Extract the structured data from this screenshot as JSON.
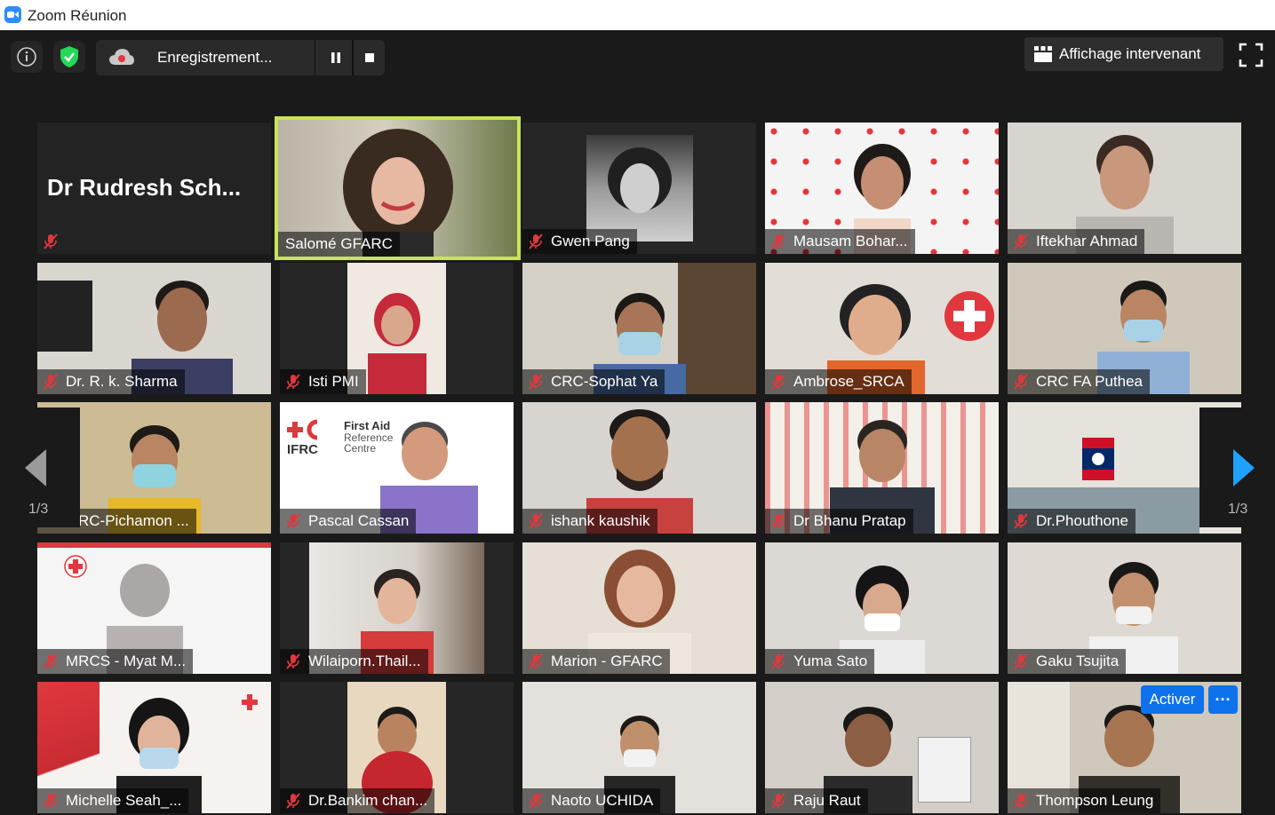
{
  "window": {
    "title": "Zoom Réunion"
  },
  "topbar": {
    "recording_label": "Enregistrement...",
    "view_label": "Affichage intervenant"
  },
  "navigation": {
    "left_page": "1/3",
    "right_page": "1/3"
  },
  "tile_actions": {
    "activate_label": "Activer",
    "more_label": "···"
  },
  "no_video_name": "Dr Rudresh Sch...",
  "participants": [
    {
      "name": "",
      "muted": true
    },
    {
      "name": "Salomé GFARC",
      "muted": false,
      "active_speaker": true
    },
    {
      "name": "Gwen Pang",
      "muted": true
    },
    {
      "name": "Mausam Bohar...",
      "muted": true
    },
    {
      "name": "Iftekhar Ahmad",
      "muted": true
    },
    {
      "name": "Dr. R. k. Sharma",
      "muted": true
    },
    {
      "name": "Isti PMI",
      "muted": true
    },
    {
      "name": "CRC-Sophat Ya",
      "muted": true
    },
    {
      "name": "Ambrose_SRCA",
      "muted": true
    },
    {
      "name": "CRC FA Puthea",
      "muted": true
    },
    {
      "name": "RC-Pichamon ...",
      "muted": true
    },
    {
      "name": "Pascal Cassan",
      "muted": true
    },
    {
      "name": "ishank kaushik",
      "muted": true
    },
    {
      "name": "Dr Bhanu Pratap",
      "muted": true
    },
    {
      "name": "Dr.Phouthone",
      "muted": true
    },
    {
      "name": "MRCS - Myat M...",
      "muted": true
    },
    {
      "name": "Wilaiporn.Thail...",
      "muted": true
    },
    {
      "name": "Marion - GFARC",
      "muted": true
    },
    {
      "name": "Yuma Sato",
      "muted": true
    },
    {
      "name": "Gaku Tsujita",
      "muted": true
    },
    {
      "name": "Michelle Seah_...",
      "muted": true
    },
    {
      "name": "Dr.Bankim chan...",
      "muted": true
    },
    {
      "name": "Naoto UCHIDA",
      "muted": true
    },
    {
      "name": "Raju Raut",
      "muted": true
    },
    {
      "name": "Thompson Leung",
      "muted": true
    }
  ],
  "colors": {
    "accent_blue": "#0e72ed",
    "active_speaker_border": "#c8e35a",
    "muted_icon": "#e0383e",
    "background": "#1a1a1a"
  }
}
